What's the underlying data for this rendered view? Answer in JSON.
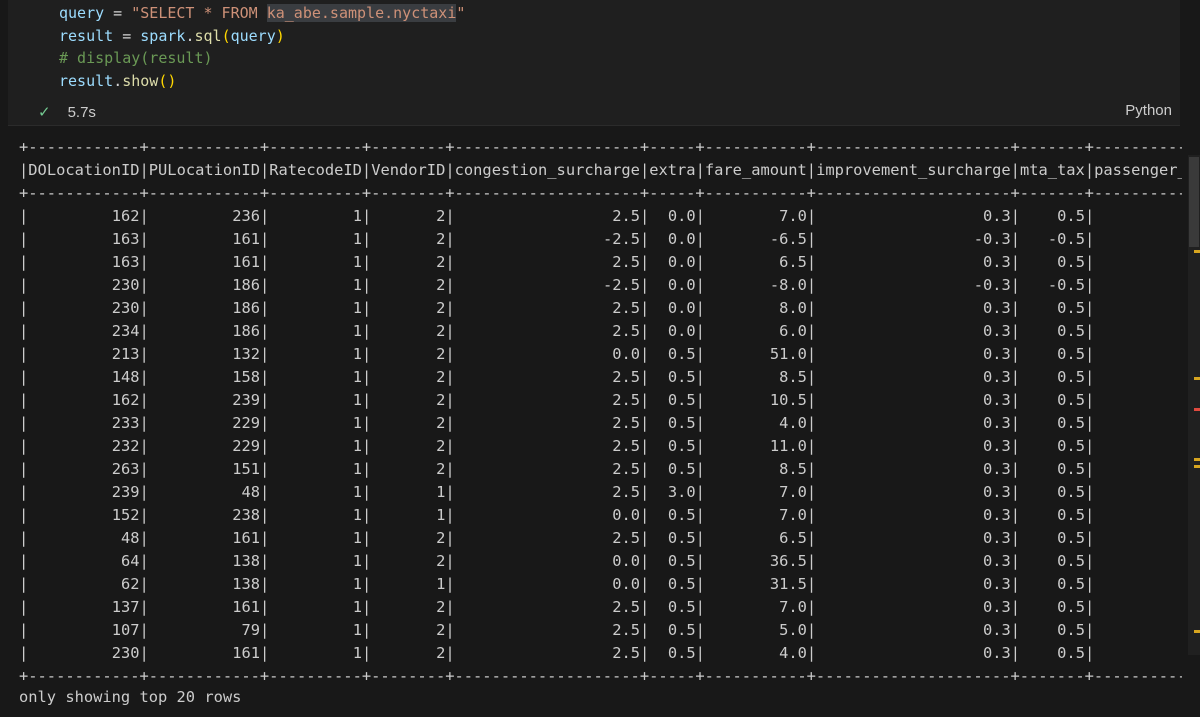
{
  "code_lines": [
    {
      "tokens": [
        {
          "t": "query",
          "c": "var"
        },
        {
          "t": " = ",
          "c": "op"
        },
        {
          "t": "\"SELECT * FROM ",
          "c": "str"
        },
        {
          "t": "ka_abe.sample.nyctaxi",
          "c": "str hl"
        },
        {
          "t": "\"",
          "c": "str"
        }
      ]
    },
    {
      "tokens": [
        {
          "t": "result",
          "c": "var"
        },
        {
          "t": " = ",
          "c": "op"
        },
        {
          "t": "spark",
          "c": "var"
        },
        {
          "t": ".",
          "c": "op"
        },
        {
          "t": "sql",
          "c": "fn"
        },
        {
          "t": "(",
          "c": "par"
        },
        {
          "t": "query",
          "c": "var"
        },
        {
          "t": ")",
          "c": "par"
        }
      ]
    },
    {
      "tokens": [
        {
          "t": "# display(result)",
          "c": "cmt"
        }
      ]
    },
    {
      "tokens": [
        {
          "t": "result",
          "c": "var"
        },
        {
          "t": ".",
          "c": "op"
        },
        {
          "t": "show",
          "c": "fn"
        },
        {
          "t": "()",
          "c": "par"
        }
      ]
    }
  ],
  "status": {
    "duration": "5.7s",
    "language": "Python"
  },
  "table": {
    "columns": [
      {
        "name": "DOLocationID",
        "width": 12
      },
      {
        "name": "PULocationID",
        "width": 12
      },
      {
        "name": "RatecodeID",
        "width": 10
      },
      {
        "name": "VendorID",
        "width": 8
      },
      {
        "name": "congestion_surcharge",
        "width": 20
      },
      {
        "name": "extra",
        "width": 5
      },
      {
        "name": "fare_amount",
        "width": 11
      },
      {
        "name": "improvement_surcharge",
        "width": 21
      },
      {
        "name": "mta_tax",
        "width": 7
      },
      {
        "name": "passenger_count",
        "width": 15
      }
    ],
    "rows": [
      [
        "162",
        "236",
        "1",
        "2",
        "2.5",
        "0.0",
        "7.0",
        "0.3",
        "0.5"
      ],
      [
        "163",
        "161",
        "1",
        "2",
        "-2.5",
        "0.0",
        "-6.5",
        "-0.3",
        "-0.5"
      ],
      [
        "163",
        "161",
        "1",
        "2",
        "2.5",
        "0.0",
        "6.5",
        "0.3",
        "0.5"
      ],
      [
        "230",
        "186",
        "1",
        "2",
        "-2.5",
        "0.0",
        "-8.0",
        "-0.3",
        "-0.5"
      ],
      [
        "230",
        "186",
        "1",
        "2",
        "2.5",
        "0.0",
        "8.0",
        "0.3",
        "0.5"
      ],
      [
        "234",
        "186",
        "1",
        "2",
        "2.5",
        "0.0",
        "6.0",
        "0.3",
        "0.5"
      ],
      [
        "213",
        "132",
        "1",
        "2",
        "0.0",
        "0.5",
        "51.0",
        "0.3",
        "0.5"
      ],
      [
        "148",
        "158",
        "1",
        "2",
        "2.5",
        "0.5",
        "8.5",
        "0.3",
        "0.5"
      ],
      [
        "162",
        "239",
        "1",
        "2",
        "2.5",
        "0.5",
        "10.5",
        "0.3",
        "0.5"
      ],
      [
        "233",
        "229",
        "1",
        "2",
        "2.5",
        "0.5",
        "4.0",
        "0.3",
        "0.5"
      ],
      [
        "232",
        "229",
        "1",
        "2",
        "2.5",
        "0.5",
        "11.0",
        "0.3",
        "0.5"
      ],
      [
        "263",
        "151",
        "1",
        "2",
        "2.5",
        "0.5",
        "8.5",
        "0.3",
        "0.5"
      ],
      [
        "239",
        "48",
        "1",
        "1",
        "2.5",
        "3.0",
        "7.0",
        "0.3",
        "0.5"
      ],
      [
        "152",
        "238",
        "1",
        "1",
        "0.0",
        "0.5",
        "7.0",
        "0.3",
        "0.5"
      ],
      [
        "48",
        "161",
        "1",
        "2",
        "2.5",
        "0.5",
        "6.5",
        "0.3",
        "0.5"
      ],
      [
        "64",
        "138",
        "1",
        "2",
        "0.0",
        "0.5",
        "36.5",
        "0.3",
        "0.5"
      ],
      [
        "62",
        "138",
        "1",
        "1",
        "0.0",
        "0.5",
        "31.5",
        "0.3",
        "0.5"
      ],
      [
        "137",
        "161",
        "1",
        "2",
        "2.5",
        "0.5",
        "7.0",
        "0.3",
        "0.5"
      ],
      [
        "107",
        "79",
        "1",
        "2",
        "2.5",
        "0.5",
        "5.0",
        "0.3",
        "0.5"
      ],
      [
        "230",
        "161",
        "1",
        "2",
        "2.5",
        "0.5",
        "4.0",
        "0.3",
        "0.5"
      ]
    ]
  },
  "footer": "only showing top 20 rows",
  "colors": {
    "check": "#73c991",
    "marker_yellow": "#d7a520",
    "marker_red": "#e04a3f"
  },
  "icons": {
    "check": "check-icon"
  }
}
